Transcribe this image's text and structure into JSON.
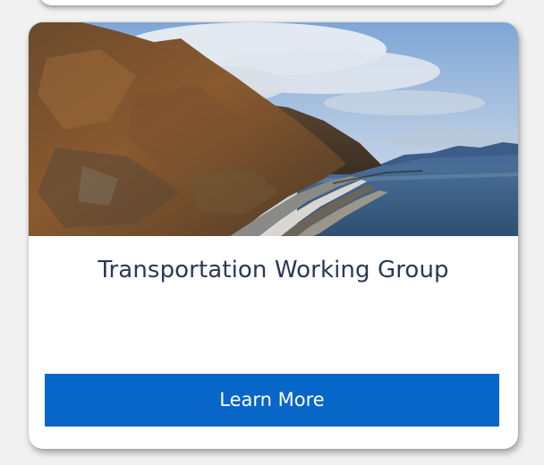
{
  "card": {
    "image_description_icon": "landscape-photo",
    "title": "Transportation Working Group",
    "button_label": "Learn More"
  },
  "colors": {
    "title_text": "#2a3857",
    "button_background": "#0866c9",
    "button_text": "#ffffff",
    "page_background": "#f1f1f1"
  }
}
